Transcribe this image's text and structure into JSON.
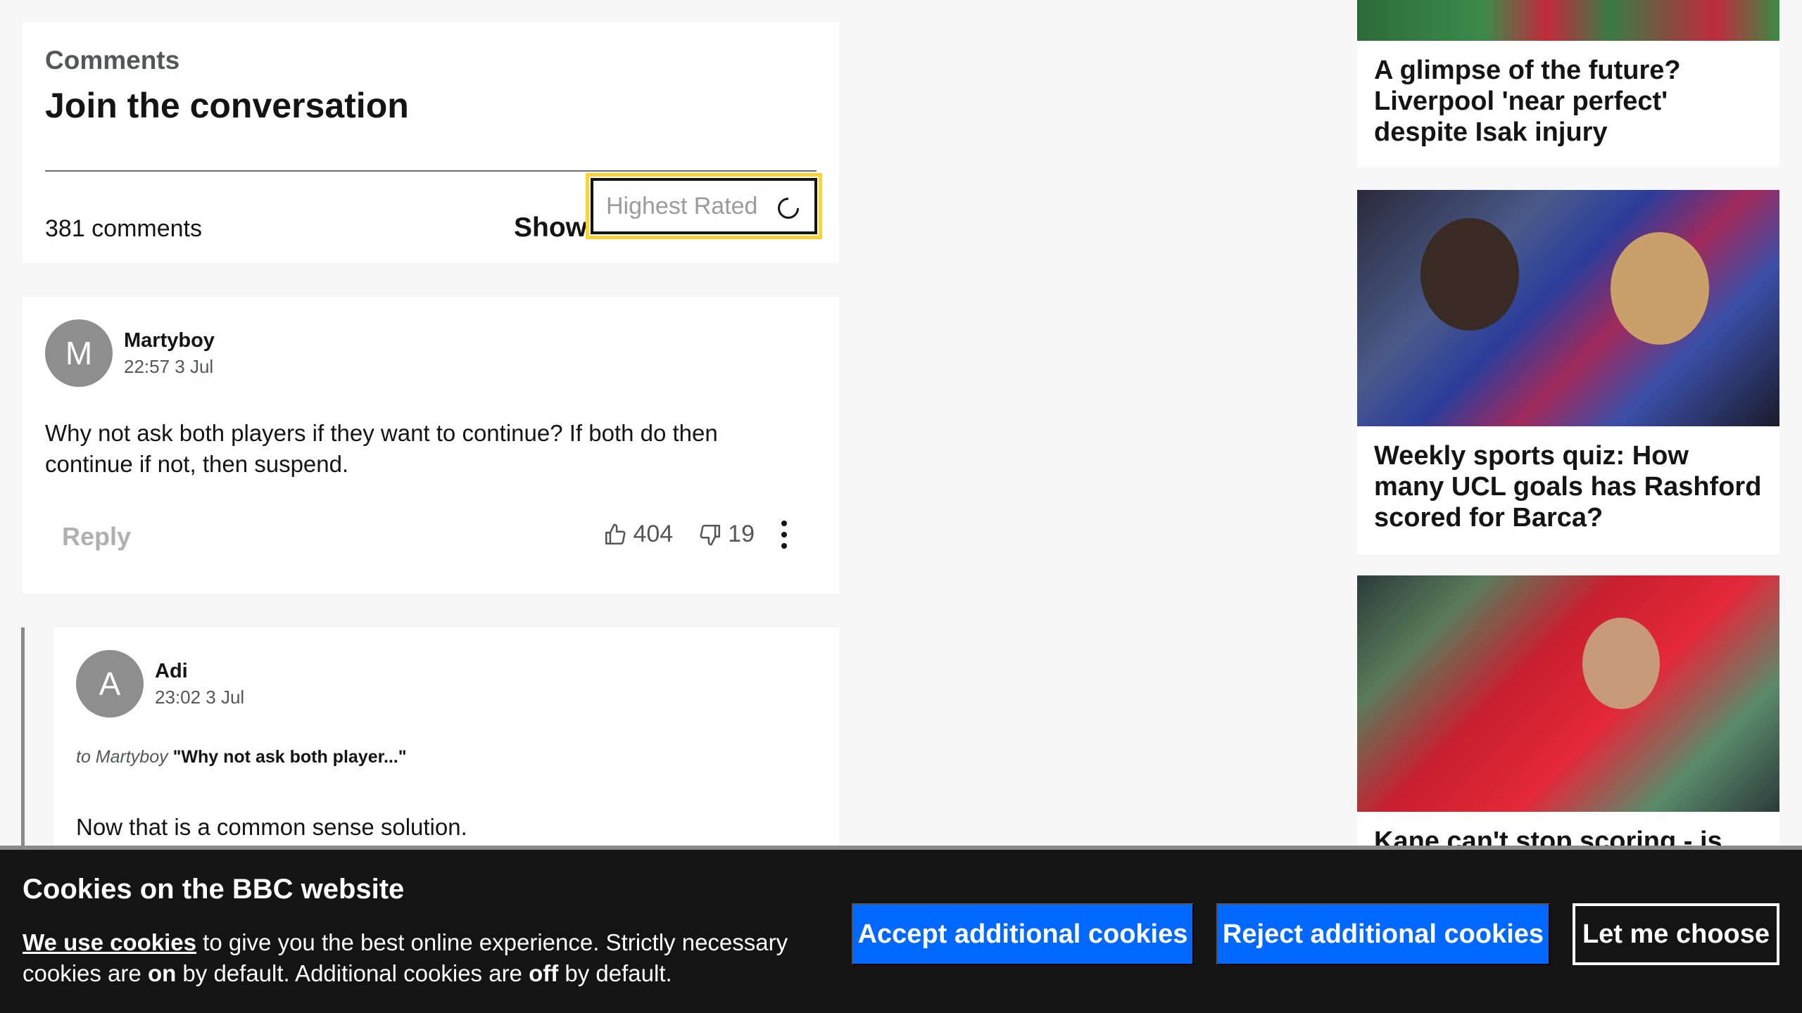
{
  "comments": {
    "kicker": "Comments",
    "title": "Join the conversation",
    "count_label": "381 comments",
    "show_label": "Show",
    "sort_value": "Highest Rated"
  },
  "comment_list": [
    {
      "avatar_initial": "M",
      "author": "Martyboy",
      "timestamp": "22:57 3 Jul",
      "text": "Why not ask both players if they want to continue? If both do then continue if not, then suspend.",
      "reply_label": "Reply",
      "upvotes": "404",
      "downvotes": "19"
    },
    {
      "avatar_initial": "A",
      "author": "Adi",
      "timestamp": "23:02 3 Jul",
      "reply_to_prefix": "to Martyboy",
      "reply_to_quote": "\"Why not ask both player...\"",
      "text": "Now that is a common sense solution."
    }
  ],
  "rail": [
    {
      "headline": "A glimpse of the future? Liverpool 'near perfect' despite Isak injury"
    },
    {
      "headline": "Weekly sports quiz: How many UCL goals has Rashford scored for Barca?"
    },
    {
      "headline": "Kane can't stop scoring - is the"
    }
  ],
  "cookie_banner": {
    "title": "Cookies on the BBC website",
    "link_text": "We use cookies",
    "text_part1": " to give you the best online experience. Strictly necessary cookies are ",
    "on_word": "on",
    "text_part2": " by default. Additional cookies are ",
    "off_word": "off",
    "text_part3": " by default.",
    "accept_label": "Accept additional cookies",
    "reject_label": "Reject additional cookies",
    "choose_label": "Let me choose"
  },
  "colors": {
    "accent_blue": "#0068ff",
    "focus_yellow": "#ffd230",
    "banner_bg": "#141414"
  }
}
